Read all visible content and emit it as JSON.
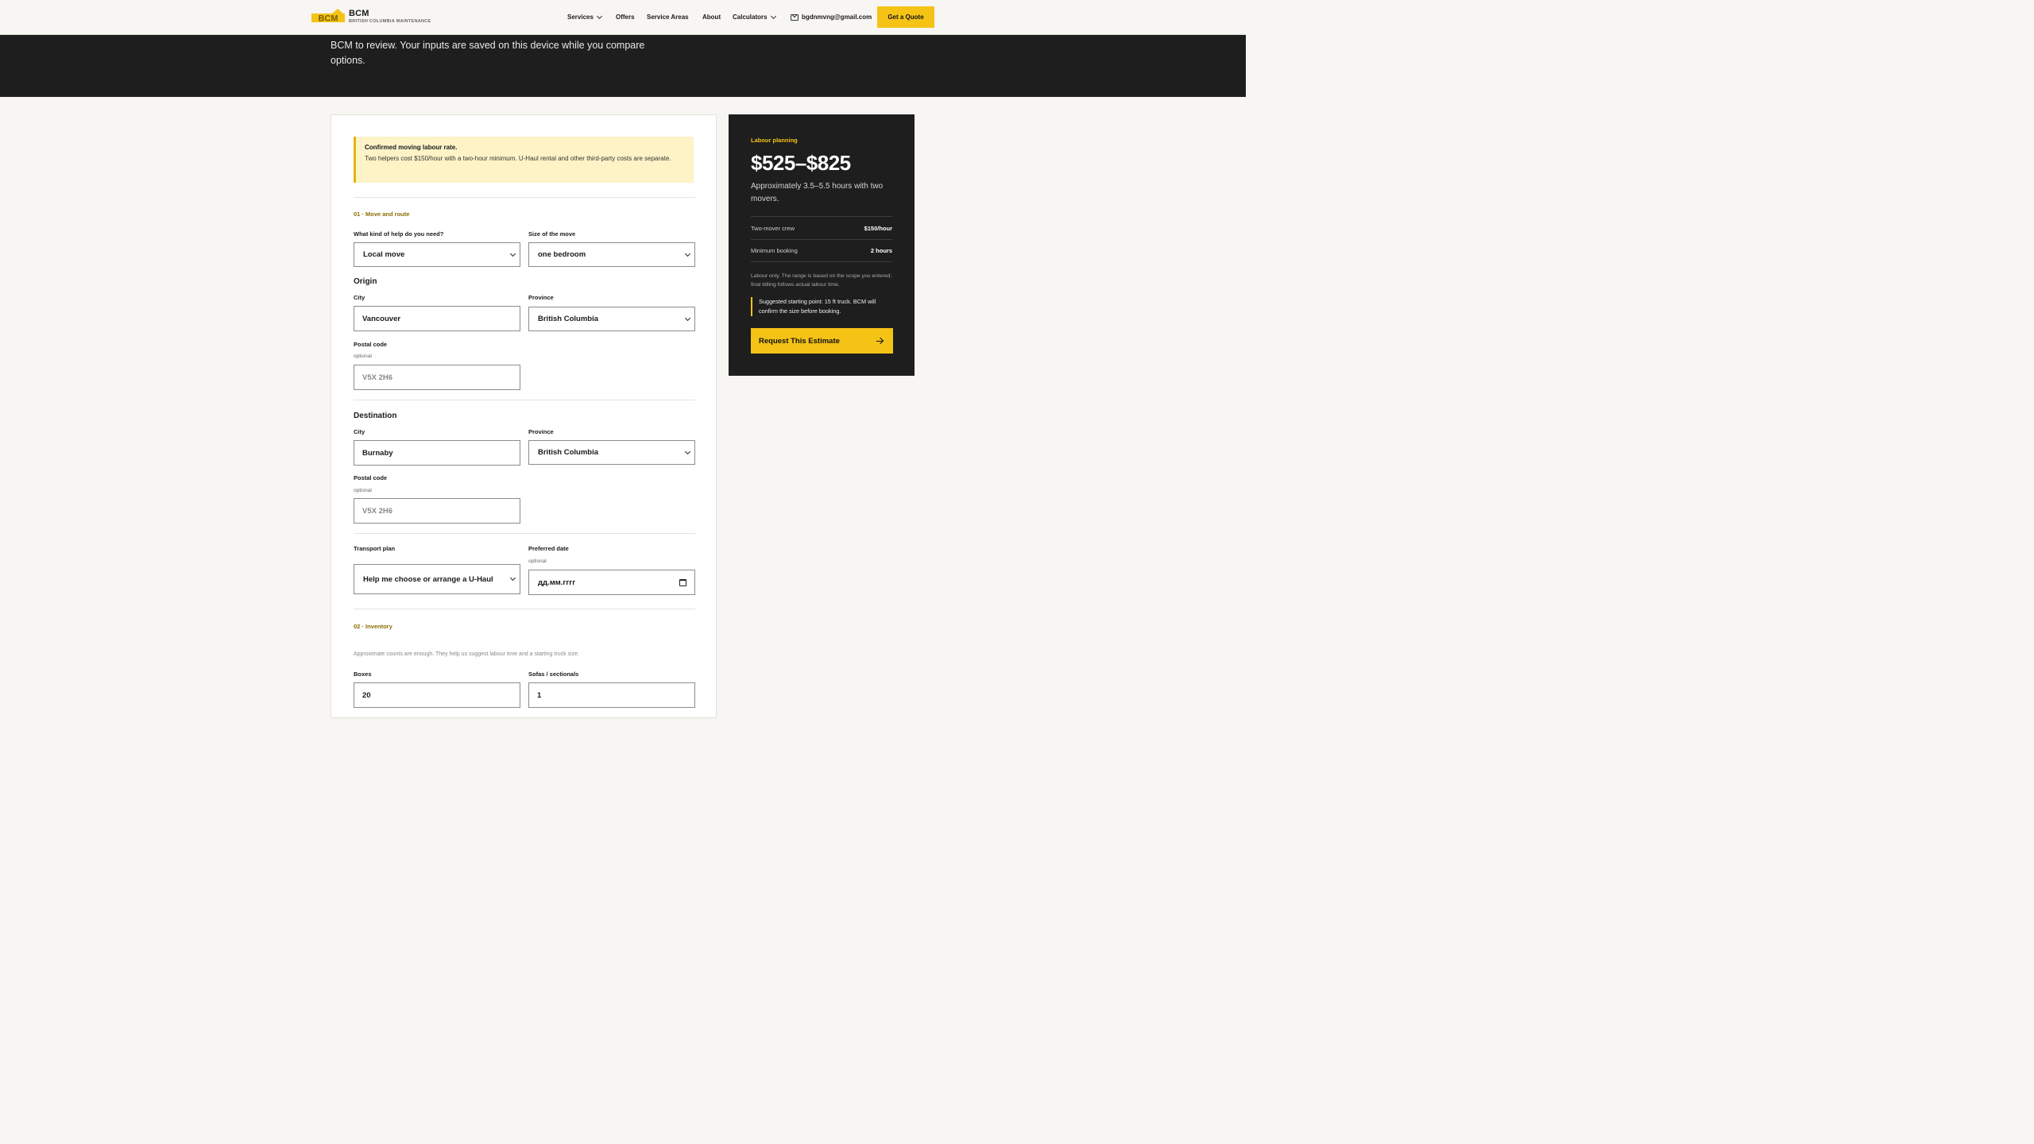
{
  "header": {
    "brand_name": "BCM",
    "brand_sub": "BRITISH COLUMBIA MAINTENANCE",
    "logo_text": "BCM",
    "nav": {
      "services": "Services",
      "offers": "Offers",
      "service_areas": "Service Areas",
      "about": "About",
      "calculators": "Calculators",
      "email": "bgdnmvng@gmail.com"
    },
    "cta": "Get a Quote"
  },
  "hero": {
    "text": "BCM to review. Your inputs are saved on this device while you compare options."
  },
  "notice": {
    "title": "Confirmed moving labour rate.",
    "body": "Two helpers cost $150/hour with a two-hour minimum. U-Haul rental and other third-party costs are separate."
  },
  "form": {
    "section1": "01 · Move and route",
    "help_label": "What kind of help do you need?",
    "help_value": "Local move",
    "size_label": "Size of the move",
    "size_value": "one bedroom",
    "origin": {
      "title": "Origin",
      "city_label": "City",
      "city_value": "Vancouver",
      "province_label": "Province",
      "province_value": "British Columbia",
      "postal_label": "Postal code",
      "postal_hint": "optional",
      "postal_placeholder": "V5X 2H6"
    },
    "destination": {
      "title": "Destination",
      "city_label": "City",
      "city_value": "Burnaby",
      "province_label": "Province",
      "province_value": "British Columbia",
      "postal_label": "Postal code",
      "postal_hint": "optional",
      "postal_placeholder": "V5X 2H6"
    },
    "transport_label": "Transport plan",
    "transport_value": "Help me choose or arrange a U-Haul",
    "date_label": "Preferred date",
    "date_hint": "optional",
    "date_value": "дд.мм.гггг",
    "section2": "02 · Inventory",
    "inventory_desc": "Approximate counts are enough. They help us suggest labour time and a starting truck size.",
    "boxes_label": "Boxes",
    "boxes_value": "20",
    "sofas_label": "Sofas / sectionals",
    "sofas_value": "1"
  },
  "summary": {
    "kicker": "Labour planning",
    "price": "$525–$825",
    "desc": "Approximately 3.5–5.5 hours with two movers.",
    "rows": [
      {
        "key": "Two-mover crew",
        "value": "$150/hour"
      },
      {
        "key": "Minimum booking",
        "value": "2 hours"
      }
    ],
    "note": "Labour only. The range is based on the scope you entered; final billing follows actual labour time.",
    "truck": "Suggested starting point: 15 ft truck. BCM will confirm the size before booking.",
    "button": "Request This Estimate"
  },
  "colors": {
    "accent": "#f5c316",
    "dark": "#1e1e1e",
    "section_label": "#8a6d00",
    "notice_bg": "#fdf3c7"
  }
}
